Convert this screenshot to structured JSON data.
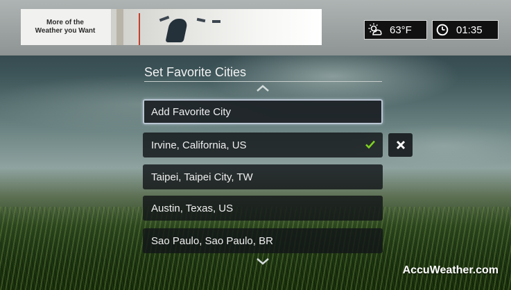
{
  "ad": {
    "line1": "More of the",
    "line2": "Weather you Want"
  },
  "status": {
    "weather_icon": "partly-sunny-icon",
    "temperature": "63°F",
    "clock_icon": "clock-icon",
    "time": "01:35"
  },
  "page": {
    "title": "Set Favorite Cities"
  },
  "list": {
    "add_label": "Add Favorite City",
    "items": [
      {
        "label": "Irvine, California, US"
      },
      {
        "label": "Taipei, Taipei City, TW"
      },
      {
        "label": "Austin, Texas, US"
      },
      {
        "label": "Sao Paulo, Sao Paulo, BR"
      }
    ]
  },
  "footer": {
    "brand": "AccuWeather.com"
  },
  "colors": {
    "check": "#7ed321",
    "focus_border": "#b9c5d3"
  }
}
